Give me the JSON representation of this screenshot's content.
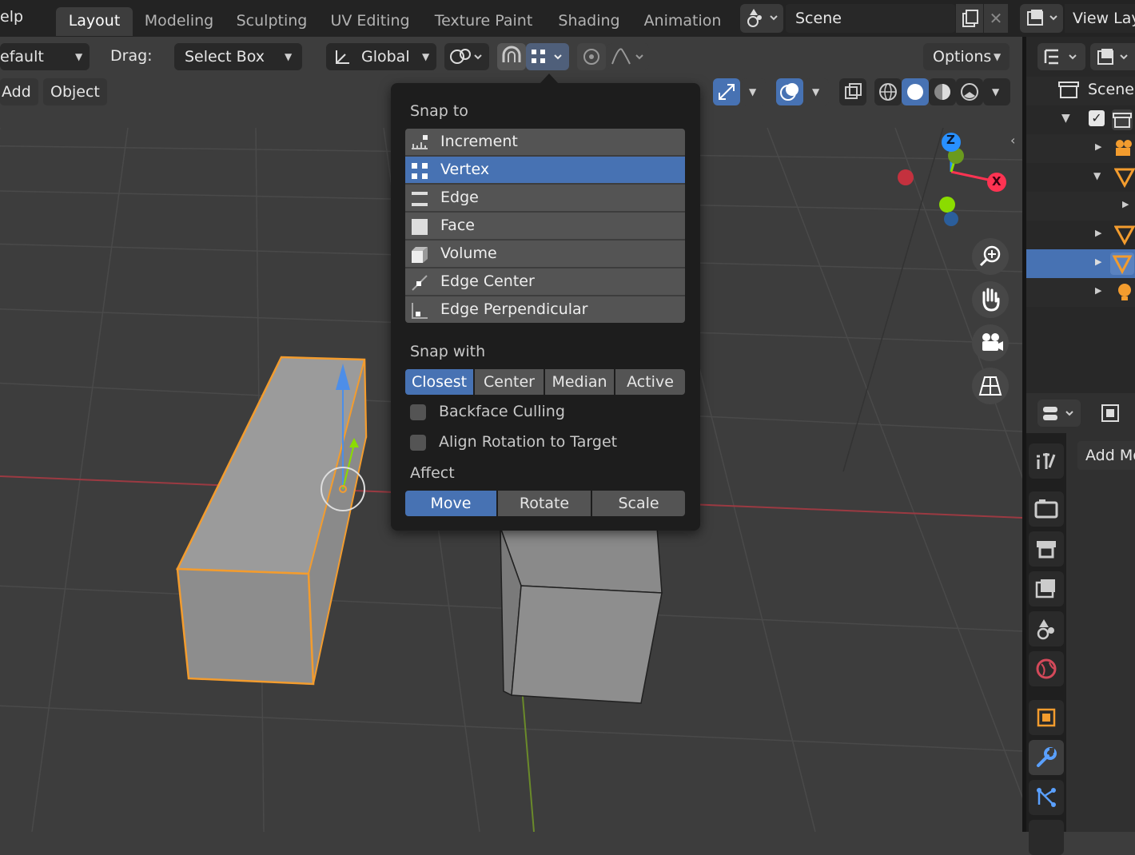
{
  "topbar": {
    "menu_help": "elp",
    "tabs": [
      "Layout",
      "Modeling",
      "Sculpting",
      "UV Editing",
      "Texture Paint",
      "Shading",
      "Animation"
    ],
    "scene_name": "Scene",
    "view_layer": "View Lay"
  },
  "viewport_header": {
    "orientation_default": "efault",
    "drag_label": "Drag:",
    "drag_value": "Select Box",
    "transform_orientation": "Global",
    "options_label": "Options",
    "menu_add": "Add",
    "menu_object": "Object"
  },
  "snap_popup": {
    "snap_to_label": "Snap to",
    "snap_to_items": [
      {
        "label": "Increment",
        "icon": "increment-icon",
        "selected": false
      },
      {
        "label": "Vertex",
        "icon": "vertex-icon",
        "selected": true
      },
      {
        "label": "Edge",
        "icon": "edge-icon",
        "selected": false
      },
      {
        "label": "Face",
        "icon": "face-icon",
        "selected": false
      },
      {
        "label": "Volume",
        "icon": "volume-icon",
        "selected": false
      },
      {
        "label": "Edge Center",
        "icon": "edge-center-icon",
        "selected": false
      },
      {
        "label": "Edge Perpendicular",
        "icon": "edge-perpendicular-icon",
        "selected": false
      }
    ],
    "snap_with_label": "Snap with",
    "snap_with_options": [
      "Closest",
      "Center",
      "Median",
      "Active"
    ],
    "snap_with_selected": "Closest",
    "backface_culling": "Backface Culling",
    "align_rotation": "Align Rotation to Target",
    "affect_label": "Affect",
    "affect_options": [
      "Move",
      "Rotate",
      "Scale"
    ],
    "affect_selected": "Move"
  },
  "gizmo": {
    "x": "X",
    "y": "Y",
    "z": "Z"
  },
  "outliner": {
    "scene": "Scene"
  },
  "properties": {
    "add_modifier": "Add Mo"
  },
  "colors": {
    "accent": "#4772b3",
    "selection_orange": "#f39c2e",
    "x_axis": "#ff3352",
    "y_axis": "#8bdc00",
    "z_axis": "#2890ff"
  }
}
